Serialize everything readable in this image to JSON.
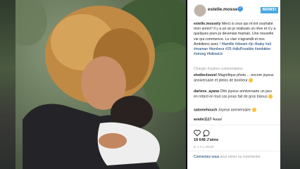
{
  "post": {
    "username": "estelle.mossely",
    "follow_label": "NOWS!",
    "caption_username": "estelle.mossely",
    "caption_text": "Merci à ceux qui m'ont souhaité mon anniv!! Il y a un an je réalisais un rêve et il y a quelques jours je devenais maman. Une nouvelle vie qui commence. Le clan s'agrandit et nos Ambitions avec !",
    "caption_tags": "#famille #dream #jo #baby #ali #maman #bonheur #25 #allsPossible #ambition #strong #followUs",
    "load_more": "Charger d'autres commentaires",
    "comments": [
      {
        "user": "elodieclouvel",
        "text": "Magnifique photo ... encore joyeux anniversaire et pleins de bonheur"
      },
      {
        "user": "darlene_ayana",
        "text": "Ohh joyeux anniversaire un peu en retard en tout cas jvous fait de gros bisous"
      },
      {
        "user": "salomehouch",
        "text": "Joyeux anniversaire"
      },
      {
        "user": "avaite1117",
        "text": "Aaaa!"
      }
    ],
    "likes": "18 648 J'aime",
    "time_ago": "IL Y A 1 JOUR",
    "login_prefix": "Connectez-vous",
    "login_suffix": "pour aimer ou commenter."
  },
  "colors": {
    "verified": "#3897f0",
    "badge": "#4aa8e0",
    "link": "#003569"
  }
}
